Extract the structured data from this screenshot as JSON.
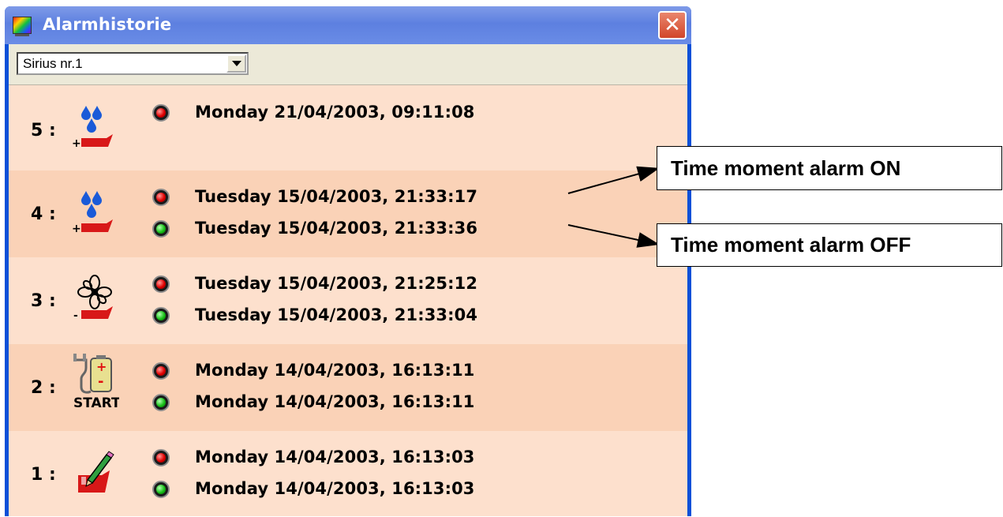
{
  "window": {
    "title": "Alarmhistorie",
    "close_label": "✕"
  },
  "selector": {
    "value": "Sirius nr.1"
  },
  "entries": [
    {
      "index": "5 :",
      "icon": "water-drops-heater-icon",
      "icon_label": "+",
      "on": "Monday 21/04/2003,  09:11:08",
      "off": ""
    },
    {
      "index": "4 :",
      "icon": "water-drops-heater-icon",
      "icon_label": "+",
      "on": "Tuesday 15/04/2003,  21:33:17",
      "off": "Tuesday 15/04/2003,  21:33:36"
    },
    {
      "index": "3 :",
      "icon": "fan-heater-icon",
      "icon_label": "-",
      "on": "Tuesday 15/04/2003,  21:25:12",
      "off": "Tuesday 15/04/2003,  21:33:04"
    },
    {
      "index": "2 :",
      "icon": "battery-plug-start-icon",
      "icon_label": "START",
      "on": "Monday 14/04/2003,  16:13:11",
      "off": "Monday 14/04/2003,  16:13:11"
    },
    {
      "index": "1 :",
      "icon": "pencil-heater-icon",
      "icon_label": "",
      "on": "Monday 14/04/2003,  16:13:03",
      "off": "Monday 14/04/2003,  16:13:03"
    }
  ],
  "callouts": {
    "on": "Time moment alarm ON",
    "off": "Time moment alarm OFF"
  },
  "colors": {
    "row_light": "#fde0cd",
    "row_dark": "#fad2b7",
    "led_on": "#e00000",
    "led_off": "#18c018",
    "titlebar": "#6a8ce6"
  }
}
